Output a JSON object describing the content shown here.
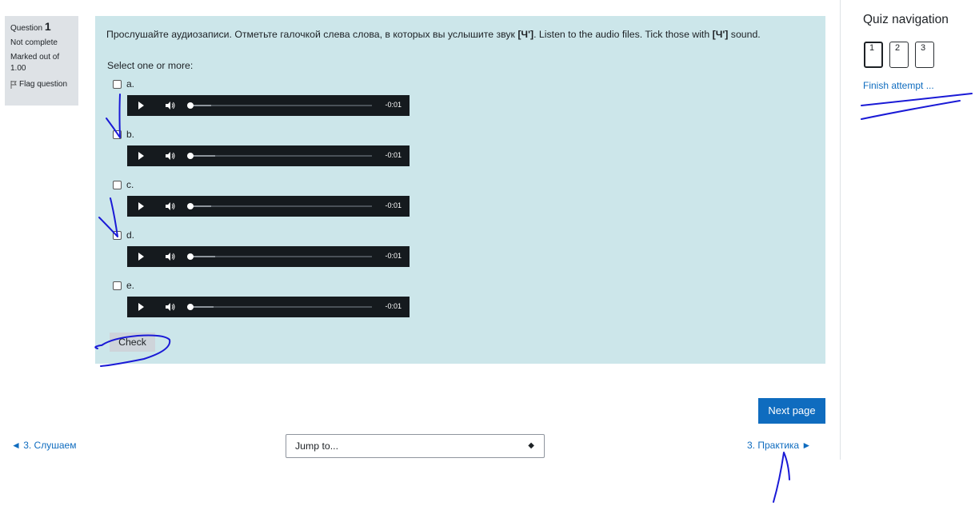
{
  "question_info": {
    "label": "Question",
    "number": "1",
    "status": "Not complete",
    "marked": "Marked out of",
    "marks": "1.00",
    "flag_label": "Flag question"
  },
  "question": {
    "text_before": "Прослушайте аудиозаписи. Отметьте галочкой слева слова, в которых вы услышите звук ",
    "sound_1": "[Ч']",
    "text_middle": ". Listen to the audio files. Tick those with ",
    "sound_2": "[Ч']",
    "text_after": " sound.",
    "prompt": "Select one or more:",
    "options": [
      {
        "label": "a.",
        "time": "-0:01",
        "buffered": 0.12
      },
      {
        "label": "b.",
        "time": "-0:01",
        "buffered": 0.14
      },
      {
        "label": "c.",
        "time": "-0:01",
        "buffered": 0.12
      },
      {
        "label": "d.",
        "time": "-0:01",
        "buffered": 0.14
      },
      {
        "label": "e.",
        "time": "-0:01",
        "buffered": 0.13
      }
    ],
    "check_label": "Check"
  },
  "footer": {
    "next_page_label": "Next page",
    "prev_link": "◄ 3. Слушаем",
    "jump_placeholder": "Jump to...",
    "next_link": "3. Практика ►"
  },
  "quiz_nav": {
    "title": "Quiz navigation",
    "pages": [
      "1",
      "2",
      "3"
    ],
    "current": "1",
    "finish_label": "Finish attempt ..."
  },
  "colors": {
    "panel": "#cce6ea",
    "link": "#0f6cbf",
    "button_primary": "#0f6cbf",
    "annotation_ink": "#1a1ad6"
  }
}
